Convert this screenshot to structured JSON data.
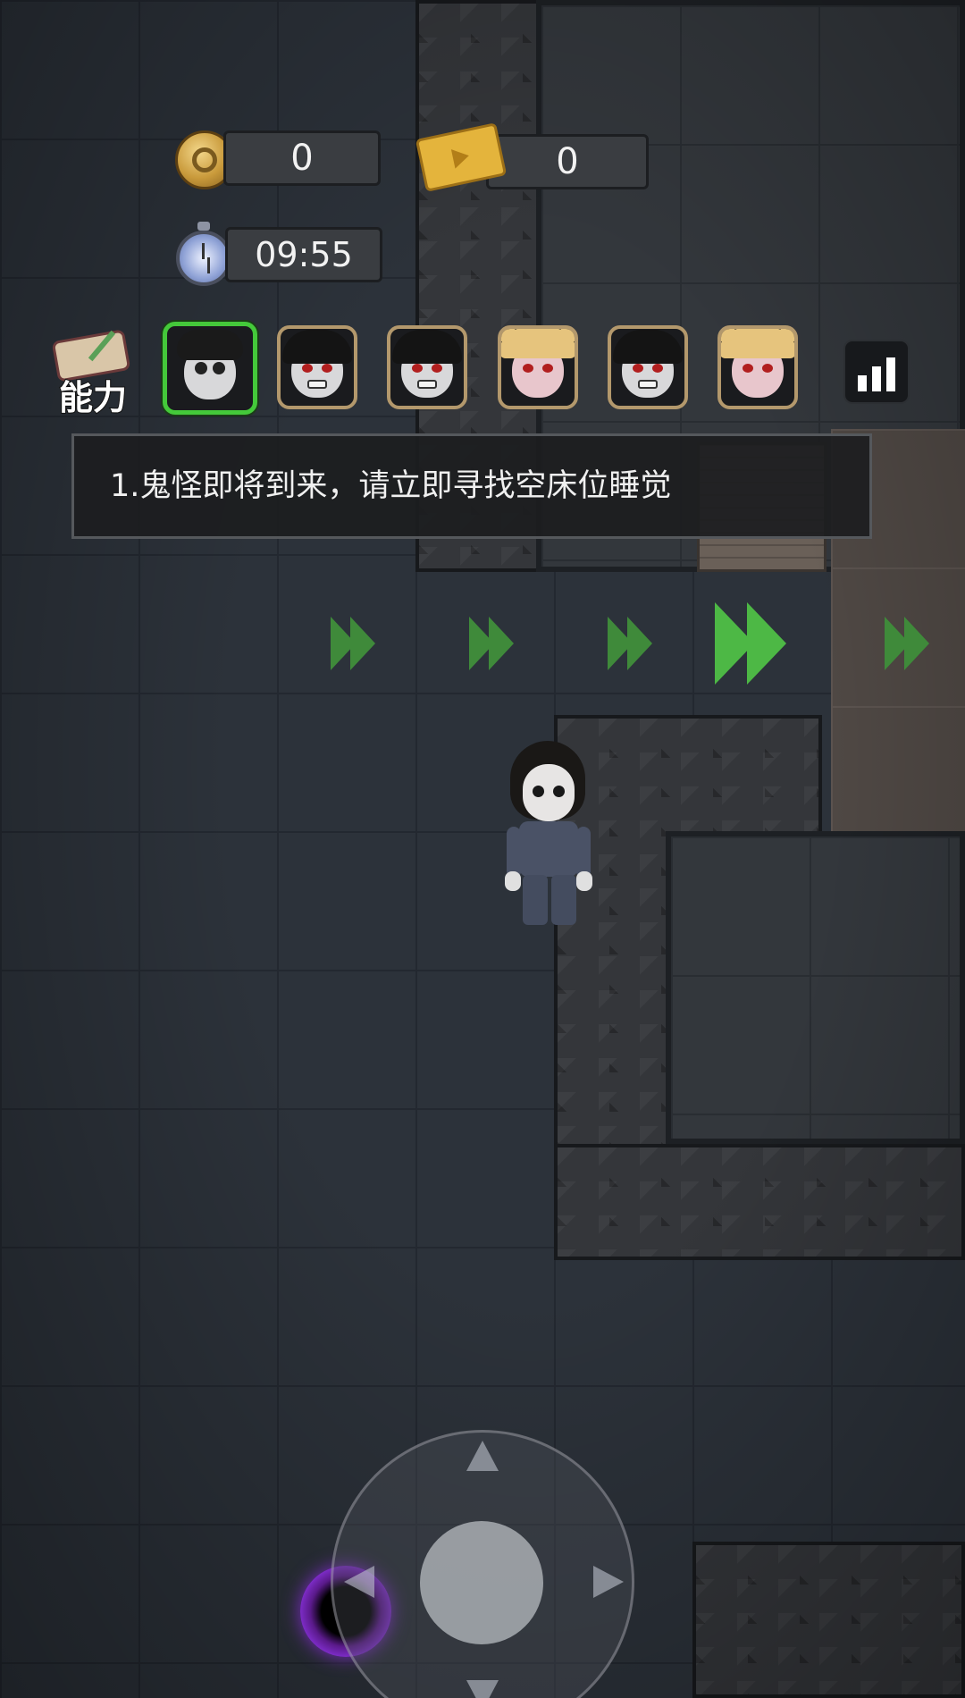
{
  "hud": {
    "coins": "0",
    "tickets": "0",
    "timer": "09:55",
    "ability_label": "能力"
  },
  "characters": [
    {
      "name": "pale-girl",
      "selected": true
    },
    {
      "name": "ghost-pale-1",
      "selected": false
    },
    {
      "name": "ghost-pale-2",
      "selected": false
    },
    {
      "name": "blonde-doll-1",
      "selected": false
    },
    {
      "name": "ghost-pale-3",
      "selected": false
    },
    {
      "name": "blonde-doll-2",
      "selected": false
    }
  ],
  "mission": {
    "text": "1.鬼怪即将到来，请立即寻找空床位睡觉"
  },
  "colors": {
    "selected_border": "#44c93a",
    "slot_border": "#b3986c",
    "chevron": "#4db845",
    "portal": "#7b2bc4"
  },
  "icons": [
    "coin-icon",
    "ticket-icon",
    "stopwatch-icon",
    "ability-scroll-icon",
    "stats-chart-icon",
    "portal-icon"
  ]
}
